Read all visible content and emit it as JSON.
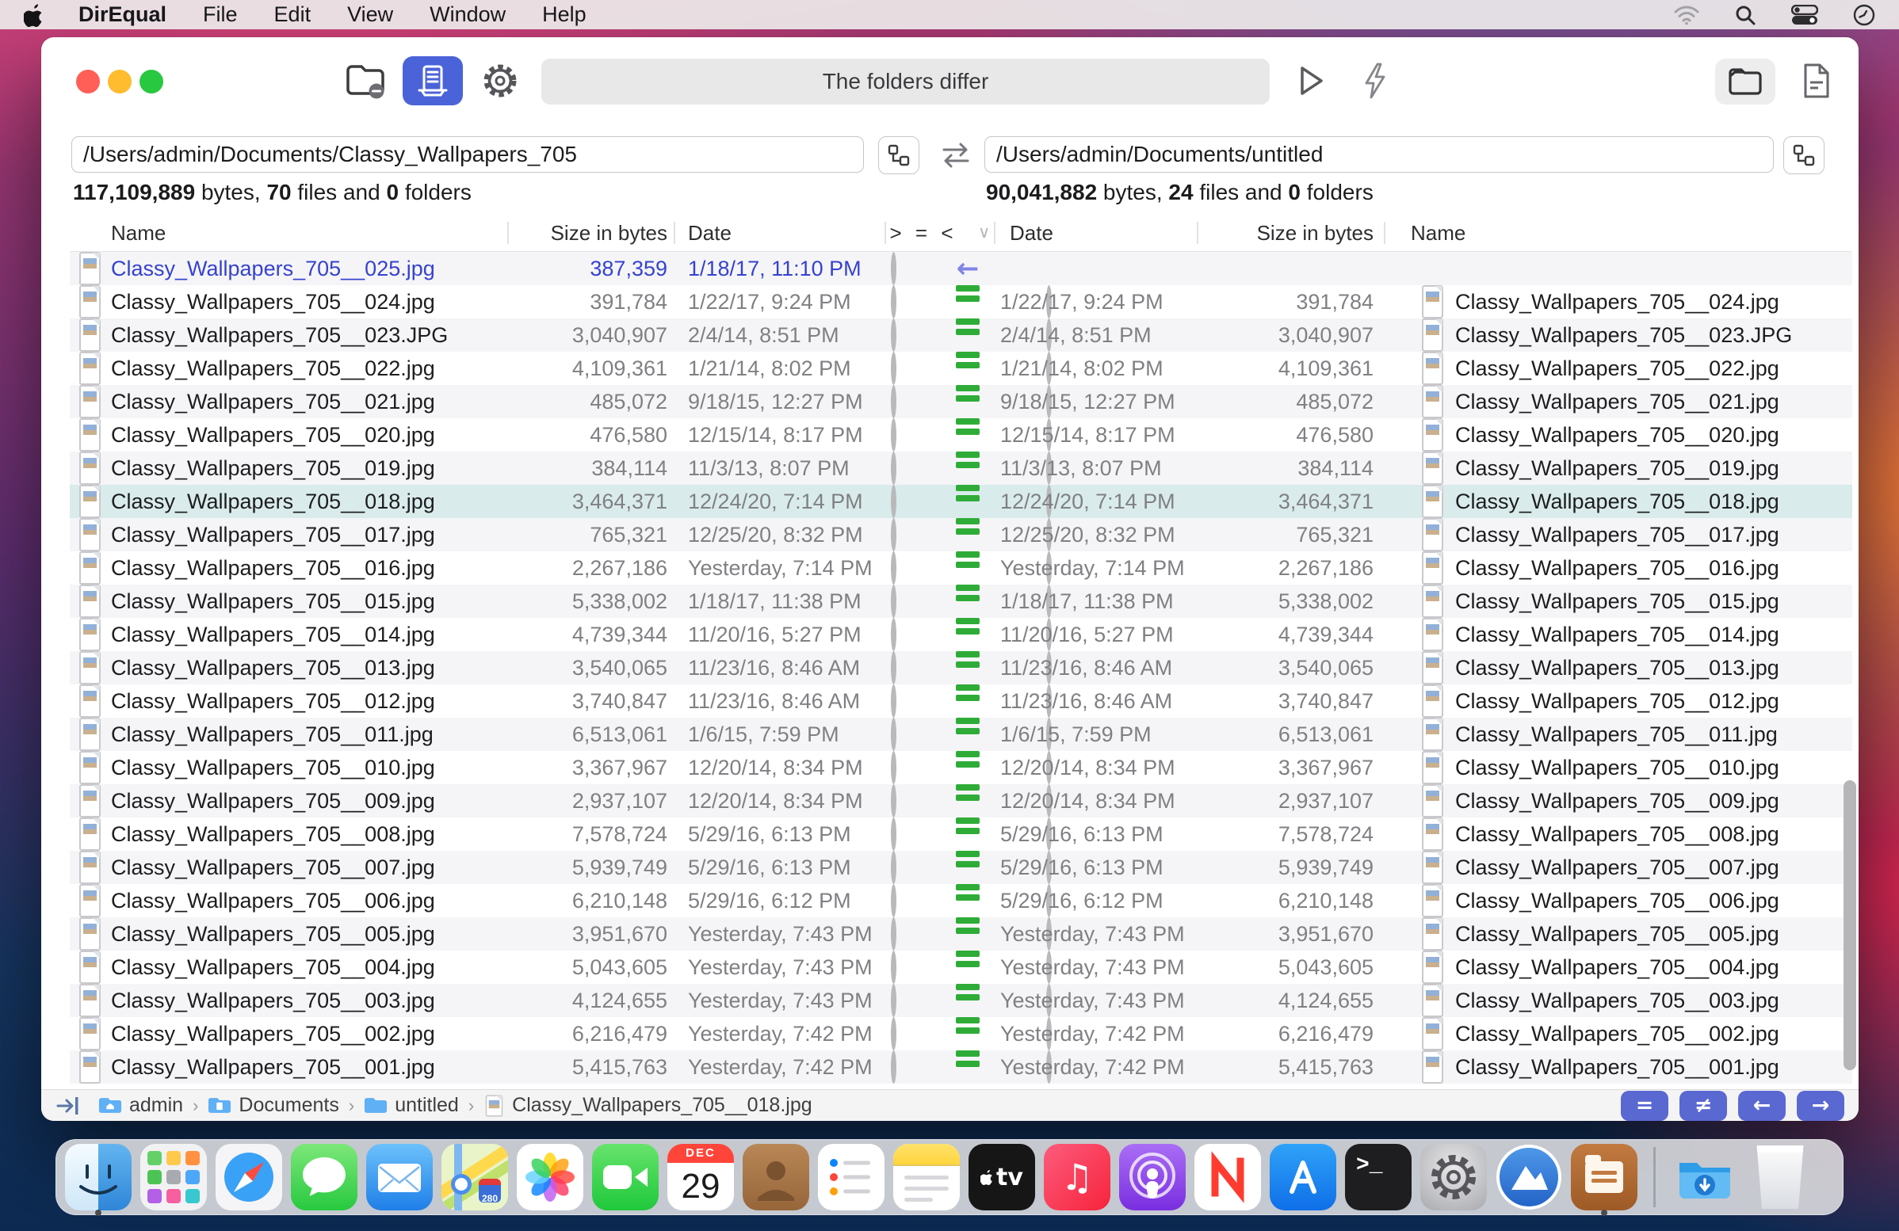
{
  "menu_bar": {
    "app_name": "DirEqual",
    "items": [
      "File",
      "Edit",
      "View",
      "Window",
      "Help"
    ],
    "status_icons": [
      "wifi-icon",
      "spotlight-search-icon",
      "control-center-icon",
      "clock-icon"
    ]
  },
  "toolbar": {
    "status_text": "The folders differ"
  },
  "panes": {
    "left": {
      "path": "/Users/admin/Documents/Classy_Wallpapers_705",
      "bytes": "117,109,889",
      "files": "70",
      "folders": "0"
    },
    "right": {
      "path": "/Users/admin/Documents/untitled",
      "bytes": "90,041,882",
      "files": "24",
      "folders": "0"
    },
    "words": {
      "bytes": "bytes,",
      "files": "files and",
      "folders": "folders"
    }
  },
  "table": {
    "headers": {
      "name": "Name",
      "size": "Size in bytes",
      "date": "Date",
      "compare": "> = <",
      "compare_chevron": "∨"
    },
    "rows": [
      {
        "name": "Classy_Wallpapers_705__025.jpg",
        "size": "387,359",
        "date": "1/18/17, 11:10 PM",
        "status": "left-only",
        "selected": false
      },
      {
        "name": "Classy_Wallpapers_705__024.jpg",
        "size": "391,784",
        "date": "1/22/17, 9:24 PM",
        "status": "equal",
        "selected": false
      },
      {
        "name": "Classy_Wallpapers_705__023.JPG",
        "size": "3,040,907",
        "date": "2/4/14, 8:51 PM",
        "status": "equal",
        "selected": false
      },
      {
        "name": "Classy_Wallpapers_705__022.jpg",
        "size": "4,109,361",
        "date": "1/21/14, 8:02 PM",
        "status": "equal",
        "selected": false
      },
      {
        "name": "Classy_Wallpapers_705__021.jpg",
        "size": "485,072",
        "date": "9/18/15, 12:27 PM",
        "status": "equal",
        "selected": false
      },
      {
        "name": "Classy_Wallpapers_705__020.jpg",
        "size": "476,580",
        "date": "12/15/14, 8:17 PM",
        "status": "equal",
        "selected": false
      },
      {
        "name": "Classy_Wallpapers_705__019.jpg",
        "size": "384,114",
        "date": "11/3/13, 8:07 PM",
        "status": "equal",
        "selected": false
      },
      {
        "name": "Classy_Wallpapers_705__018.jpg",
        "size": "3,464,371",
        "date": "12/24/20, 7:14 PM",
        "status": "equal",
        "selected": true
      },
      {
        "name": "Classy_Wallpapers_705__017.jpg",
        "size": "765,321",
        "date": "12/25/20, 8:32 PM",
        "status": "equal",
        "selected": false
      },
      {
        "name": "Classy_Wallpapers_705__016.jpg",
        "size": "2,267,186",
        "date": "Yesterday, 7:14 PM",
        "status": "equal",
        "selected": false
      },
      {
        "name": "Classy_Wallpapers_705__015.jpg",
        "size": "5,338,002",
        "date": "1/18/17, 11:38 PM",
        "status": "equal",
        "selected": false
      },
      {
        "name": "Classy_Wallpapers_705__014.jpg",
        "size": "4,739,344",
        "date": "11/20/16, 5:27 PM",
        "status": "equal",
        "selected": false
      },
      {
        "name": "Classy_Wallpapers_705__013.jpg",
        "size": "3,540,065",
        "date": "11/23/16, 8:46 AM",
        "status": "equal",
        "selected": false
      },
      {
        "name": "Classy_Wallpapers_705__012.jpg",
        "size": "3,740,847",
        "date": "11/23/16, 8:46 AM",
        "status": "equal",
        "selected": false
      },
      {
        "name": "Classy_Wallpapers_705__011.jpg",
        "size": "6,513,061",
        "date": "1/6/15, 7:59 PM",
        "status": "equal",
        "selected": false
      },
      {
        "name": "Classy_Wallpapers_705__010.jpg",
        "size": "3,367,967",
        "date": "12/20/14, 8:34 PM",
        "status": "equal",
        "selected": false
      },
      {
        "name": "Classy_Wallpapers_705__009.jpg",
        "size": "2,937,107",
        "date": "12/20/14, 8:34 PM",
        "status": "equal",
        "selected": false
      },
      {
        "name": "Classy_Wallpapers_705__008.jpg",
        "size": "7,578,724",
        "date": "5/29/16, 6:13 PM",
        "status": "equal",
        "selected": false
      },
      {
        "name": "Classy_Wallpapers_705__007.jpg",
        "size": "5,939,749",
        "date": "5/29/16, 6:13 PM",
        "status": "equal",
        "selected": false
      },
      {
        "name": "Classy_Wallpapers_705__006.jpg",
        "size": "6,210,148",
        "date": "5/29/16, 6:12 PM",
        "status": "equal",
        "selected": false
      },
      {
        "name": "Classy_Wallpapers_705__005.jpg",
        "size": "3,951,670",
        "date": "Yesterday, 7:43 PM",
        "status": "equal",
        "selected": false
      },
      {
        "name": "Classy_Wallpapers_705__004.jpg",
        "size": "5,043,605",
        "date": "Yesterday, 7:43 PM",
        "status": "equal",
        "selected": false
      },
      {
        "name": "Classy_Wallpapers_705__003.jpg",
        "size": "4,124,655",
        "date": "Yesterday, 7:43 PM",
        "status": "equal",
        "selected": false
      },
      {
        "name": "Classy_Wallpapers_705__002.jpg",
        "size": "6,216,479",
        "date": "Yesterday, 7:42 PM",
        "status": "equal",
        "selected": false
      },
      {
        "name": "Classy_Wallpapers_705__001.jpg",
        "size": "5,415,763",
        "date": "Yesterday, 7:42 PM",
        "status": "equal",
        "selected": false
      }
    ]
  },
  "statusbar": {
    "breadcrumb": [
      {
        "label": "admin",
        "icon": "home-folder-icon"
      },
      {
        "label": "Documents",
        "icon": "documents-folder-icon"
      },
      {
        "label": "untitled",
        "icon": "folder-icon"
      },
      {
        "label": "Classy_Wallpapers_705__018.jpg",
        "icon": "file-icon"
      }
    ],
    "buttons": [
      {
        "id": "show-equal-button",
        "glyph": "="
      },
      {
        "id": "show-different-button",
        "glyph": "≠"
      },
      {
        "id": "copy-left-button",
        "glyph": "←"
      },
      {
        "id": "copy-right-button",
        "glyph": "→"
      }
    ]
  },
  "dock": {
    "apps": [
      {
        "id": "finder",
        "label": "Finder",
        "running": true
      },
      {
        "id": "launchpad",
        "label": "Launchpad",
        "running": false
      },
      {
        "id": "safari",
        "label": "Safari",
        "running": false
      },
      {
        "id": "messages",
        "label": "Messages",
        "running": false
      },
      {
        "id": "mail",
        "label": "Mail",
        "running": false
      },
      {
        "id": "maps",
        "label": "Maps",
        "running": false
      },
      {
        "id": "photos",
        "label": "Photos",
        "running": false
      },
      {
        "id": "facetime",
        "label": "FaceTime",
        "running": false
      },
      {
        "id": "calendar",
        "label": "Calendar",
        "running": false,
        "month": "DEC",
        "day": "29"
      },
      {
        "id": "contacts",
        "label": "Contacts",
        "running": false
      },
      {
        "id": "reminders",
        "label": "Reminders",
        "running": false
      },
      {
        "id": "notes",
        "label": "Notes",
        "running": false
      },
      {
        "id": "appletv",
        "label": "Apple TV",
        "running": false
      },
      {
        "id": "music",
        "label": "Music",
        "running": false
      },
      {
        "id": "podcasts",
        "label": "Podcasts",
        "running": false
      },
      {
        "id": "news",
        "label": "News",
        "running": false
      },
      {
        "id": "appstore",
        "label": "App Store",
        "running": false
      },
      {
        "id": "terminal",
        "label": "Terminal",
        "running": false
      },
      {
        "id": "settings",
        "label": "System Preferences",
        "running": false
      },
      {
        "id": "mountainapp",
        "label": "Mountain App",
        "running": false
      },
      {
        "id": "direqual",
        "label": "DirEqual",
        "running": true
      },
      {
        "id": "separator",
        "label": "",
        "running": false
      },
      {
        "id": "downloads",
        "label": "Downloads",
        "running": false
      },
      {
        "id": "trash",
        "label": "Trash",
        "running": false
      }
    ]
  },
  "colors": {
    "accent_blue": "#4b63d8",
    "equal_green": "#2fac38",
    "selection": "#d9eceb",
    "left_only_text": "#3642cf",
    "left_only_arrow": "#8084e6",
    "status_button": "#5a68d2"
  }
}
